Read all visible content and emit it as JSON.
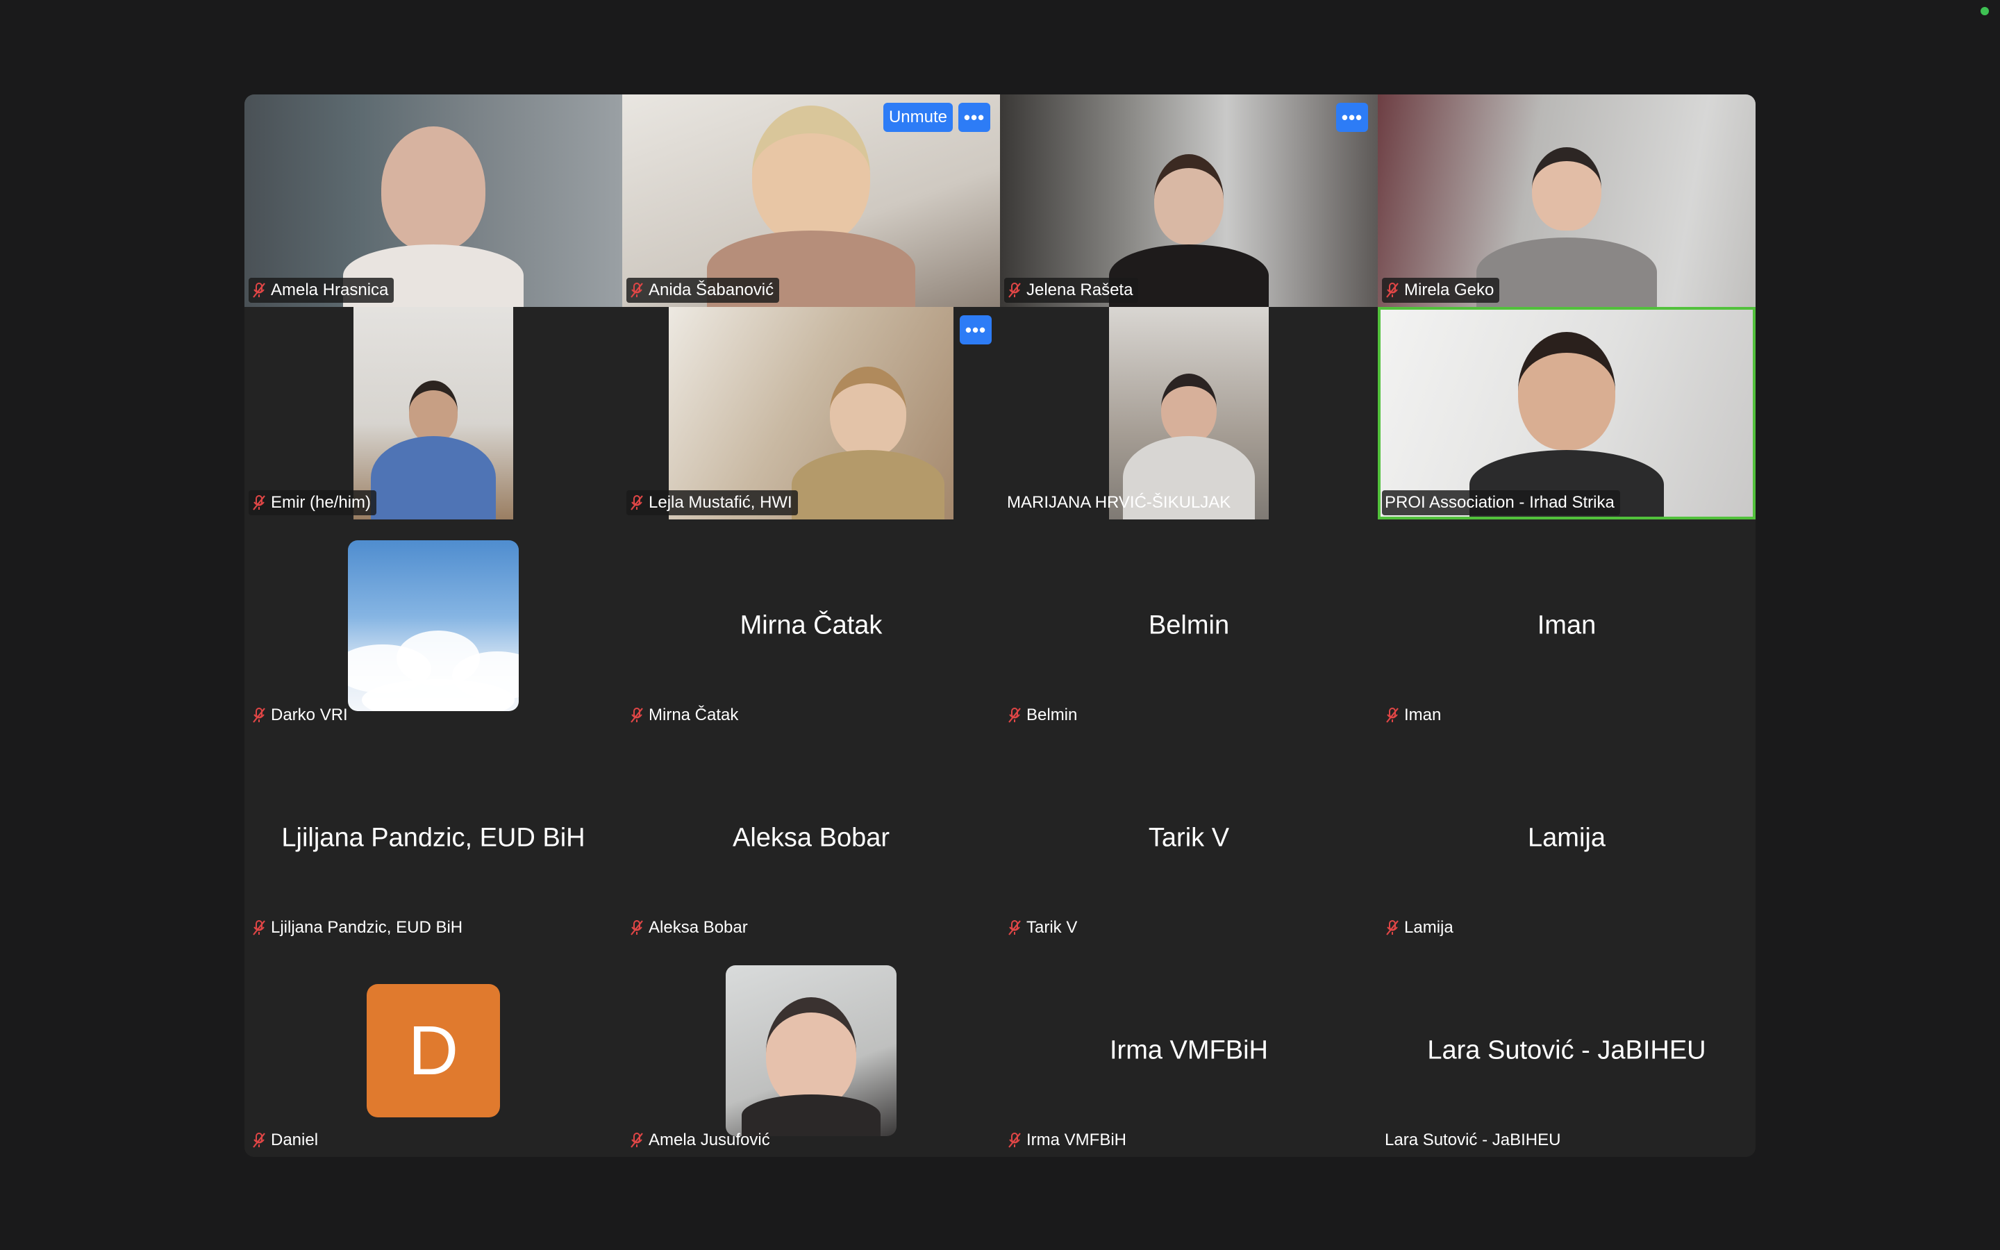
{
  "window": {
    "status_color": "#3ec153"
  },
  "controls": {
    "unmute_label": "Unmute",
    "more_label": "•••"
  },
  "participants": [
    {
      "name": "Amela Hrasnica",
      "muted": true
    },
    {
      "name": "Anida Šabanović",
      "muted": true
    },
    {
      "name": "Jelena Rašeta",
      "muted": true
    },
    {
      "name": "Mirela Geko",
      "muted": true
    },
    {
      "name": "Emir (he/him)",
      "muted": true
    },
    {
      "name": "Lejla Mustafić, HWI",
      "muted": true
    },
    {
      "name": "MARIJANA HRVIĆ-ŠIKULJAK",
      "muted": false
    },
    {
      "name": "PROI Association - Irhad Strika",
      "muted": false,
      "active_speaker": true
    },
    {
      "name": "Darko VRI",
      "muted": true
    },
    {
      "name": "Mirna Čatak",
      "muted": true
    },
    {
      "name": "Belmin",
      "muted": true
    },
    {
      "name": "Iman",
      "muted": true
    },
    {
      "name": "Ljiljana Pandzic, EUD BiH",
      "muted": true
    },
    {
      "name": "Aleksa Bobar",
      "muted": true
    },
    {
      "name": "Tarik V",
      "muted": true
    },
    {
      "name": "Lamija",
      "muted": true
    },
    {
      "name": "Daniel",
      "muted": true,
      "initial": "D"
    },
    {
      "name": "Amela Jusufović",
      "muted": true
    },
    {
      "name": "Irma VMFBiH",
      "muted": true
    },
    {
      "name": "Lara Sutović - JaBIHEU",
      "muted": false
    }
  ]
}
